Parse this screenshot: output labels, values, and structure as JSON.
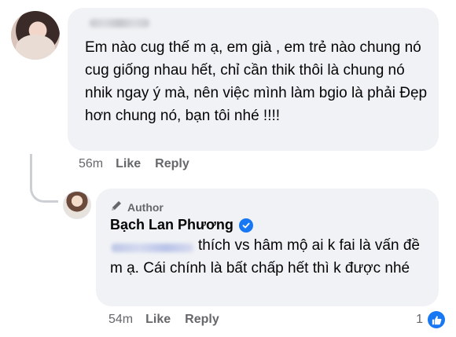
{
  "comment1": {
    "text": "Em nào cug thế m ạ, em già , em trẻ nào chung nó cug giống nhau hết, chỉ cần thik thôi là chung nó nhik ngay ý mà, nên việc mình làm bgio là phải Đẹp hơn chung nó, bạn tôi nhé !!!!",
    "time": "56m",
    "like_label": "Like",
    "reply_label": "Reply"
  },
  "comment2": {
    "author_badge": "Author",
    "author_name": "Bạch Lan Phương",
    "text": "thích vs hâm mộ ai k fai là vấn đề m ạ. Cái chính là bất chấp hết thì k được nhé",
    "time": "54m",
    "like_label": "Like",
    "reply_label": "Reply",
    "reaction_count": "1"
  },
  "colors": {
    "bubble": "#f0f2f5",
    "meta_text": "#65676b",
    "accent": "#1877f2"
  },
  "icons": [
    "author-pen-icon",
    "verified-badge-icon",
    "like-reaction-icon"
  ]
}
